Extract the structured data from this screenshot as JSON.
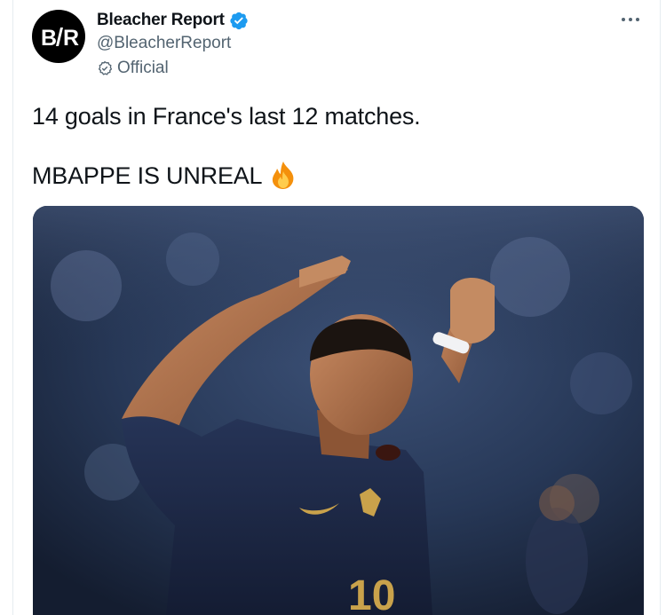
{
  "tweet": {
    "author": {
      "display_name": "Bleacher Report",
      "handle": "@BleacherReport",
      "label": "Official",
      "avatar_text": "B/R",
      "verified": true
    },
    "text_line1": "14 goals in France's last 12 matches.",
    "text_line2": "MBAPPE IS UNREAL",
    "emoji": "fire-emoji",
    "media": {
      "type": "photo",
      "jersey_number": "10"
    }
  },
  "colors": {
    "verified_blue": "#1d9bf0",
    "secondary_text": "#536471",
    "primary_text": "#0f1419",
    "jersey_navy": "#1c2644"
  }
}
